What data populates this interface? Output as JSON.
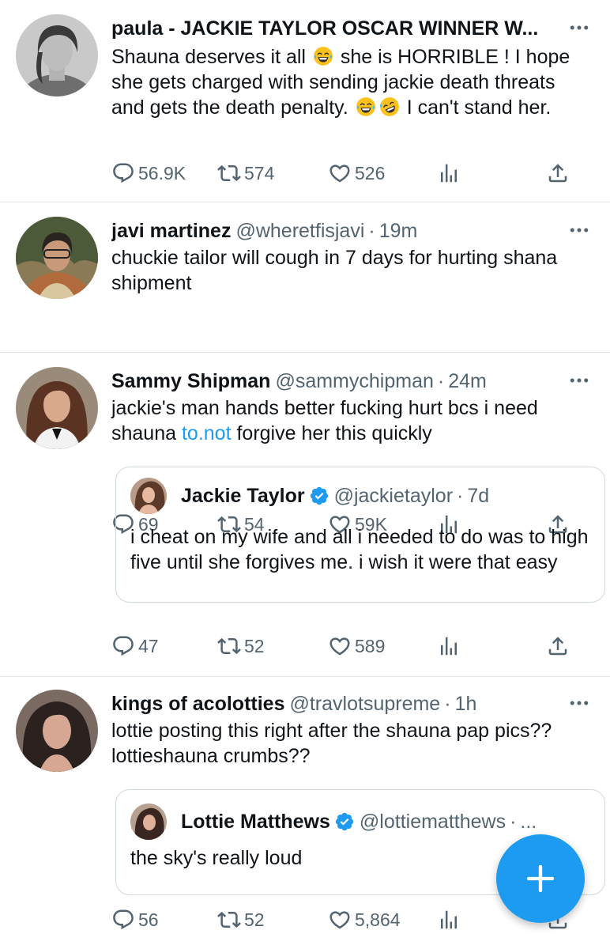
{
  "accent_color": "#1d9bf0",
  "tweets": [
    {
      "name": "paula - JACKIE TAYLOR OSCAR WINNER W...",
      "handle": "",
      "time": "",
      "lines": [
        "Shauna deserves it all",
        "she is HORRIBLE ! I hope she gets charged with sending jackie death threats and gets the death penalty.",
        "I can't stand her."
      ],
      "emoji": [
        "face-with-tears-of-joy",
        "face-with-tears-of-joy",
        "rolling-on-floor-laughing"
      ],
      "stats": {
        "replies": "56.9K",
        "retweets": "574",
        "likes": "526"
      }
    },
    {
      "name": "javi martinez",
      "handle": "@wheretfisjavi",
      "time": "19m",
      "text": "chuckie tailor will cough in 7 days for hurting shana shipment",
      "stats": {
        "replies": "69",
        "retweets": "54",
        "likes": "59K"
      }
    },
    {
      "name": "Sammy Shipman",
      "handle": "@sammychipman",
      "time": "24m",
      "text_before": "jackie's man hands better fucking hurt bcs i need shauna ",
      "link": "to.not",
      "text_after": " forgive her this quickly",
      "quote": {
        "name": "Jackie Taylor",
        "handle": "@jackietaylor",
        "time": "7d",
        "text": "i cheat on my wife and all i needed to do was to high five until she forgives me. i wish it were that easy"
      },
      "stats": {
        "replies": "47",
        "retweets": "52",
        "likes": "589"
      }
    },
    {
      "name": "kings of acolotties",
      "handle": "@travlotsupreme",
      "time": "1h",
      "text": "lottie posting this right after the shauna pap pics?? lottieshauna crumbs??",
      "quote": {
        "name": "Lottie Matthews",
        "handle": "@lottiematthews",
        "time": "...",
        "text": "the sky's really loud"
      },
      "stats": {
        "replies": "56",
        "retweets": "52",
        "likes": "5,864"
      }
    }
  ],
  "icons": {
    "reply": "reply-icon",
    "retweet": "retweet-icon",
    "like": "heart-icon",
    "stats": "analytics-icon",
    "share": "share-icon",
    "more": "more-dots-icon",
    "verified": "verified-badge-icon",
    "compose": "plus-icon"
  }
}
